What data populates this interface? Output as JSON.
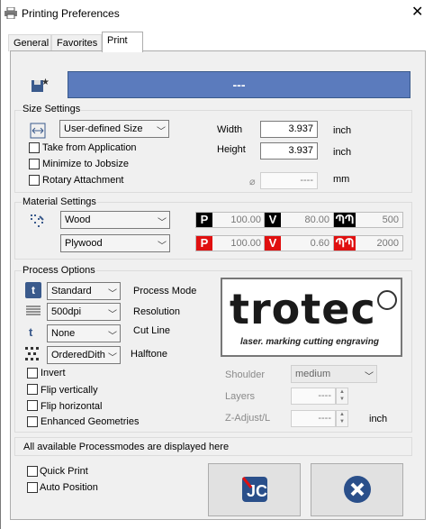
{
  "window": {
    "title": "Printing Preferences",
    "close": "✕"
  },
  "tabs": [
    {
      "label": "General"
    },
    {
      "label": "Favorites"
    },
    {
      "label": "Print"
    }
  ],
  "banner": {
    "text": "---",
    "color": "#5b7bbd"
  },
  "size": {
    "group": "Size Settings",
    "size_select": "User-defined Size",
    "width_label": "Width",
    "width_value": "3.937",
    "height_label": "Height",
    "height_value": "3.937",
    "unit": "inch",
    "unit2": "inch",
    "take_from_app": "Take from Application",
    "minimize": "Minimize to Jobsize",
    "rotary": "Rotary Attachment",
    "diameter_symbol": "⌀",
    "diameter_value": "----",
    "diameter_unit": "mm"
  },
  "material": {
    "group": "Material Settings",
    "material": "Wood",
    "type": "Plywood",
    "row1": [
      {
        "icon": "P",
        "value": "100.00",
        "color": "#000"
      },
      {
        "icon": "V",
        "value": "80.00",
        "color": "#000"
      },
      {
        "icon": "f",
        "value": "500",
        "color": "#000"
      }
    ],
    "row2": [
      {
        "icon": "P",
        "value": "100.00",
        "color": "#e01010"
      },
      {
        "icon": "V",
        "value": "0.60",
        "color": "#e01010"
      },
      {
        "icon": "f",
        "value": "2000",
        "color": "#e01010"
      }
    ]
  },
  "process": {
    "group": "Process Options",
    "mode": "Standard",
    "mode_label": "Process Mode",
    "resolution": "500dpi",
    "resolution_label": "Resolution",
    "cutline": "None",
    "cutline_label": "Cut Line",
    "halftone": "OrderedDith",
    "halftone_label": "Halftone",
    "invert": "Invert",
    "flip_v": "Flip vertically",
    "flip_h": "Flip horizontal",
    "enhanced": "Enhanced Geometries",
    "shoulder_label": "Shoulder",
    "shoulder_value": "medium",
    "layers_label": "Layers",
    "layers_value": "----",
    "zadjust_label": "Z-Adjust/L",
    "zadjust_value": "----",
    "zadjust_unit": "inch"
  },
  "logo": {
    "brand": "trotec",
    "tagline": "laser. marking cutting engraving"
  },
  "status": "All available Processmodes are displayed here",
  "bottom": {
    "quick_print": "Quick Print",
    "auto_position": "Auto Position"
  }
}
